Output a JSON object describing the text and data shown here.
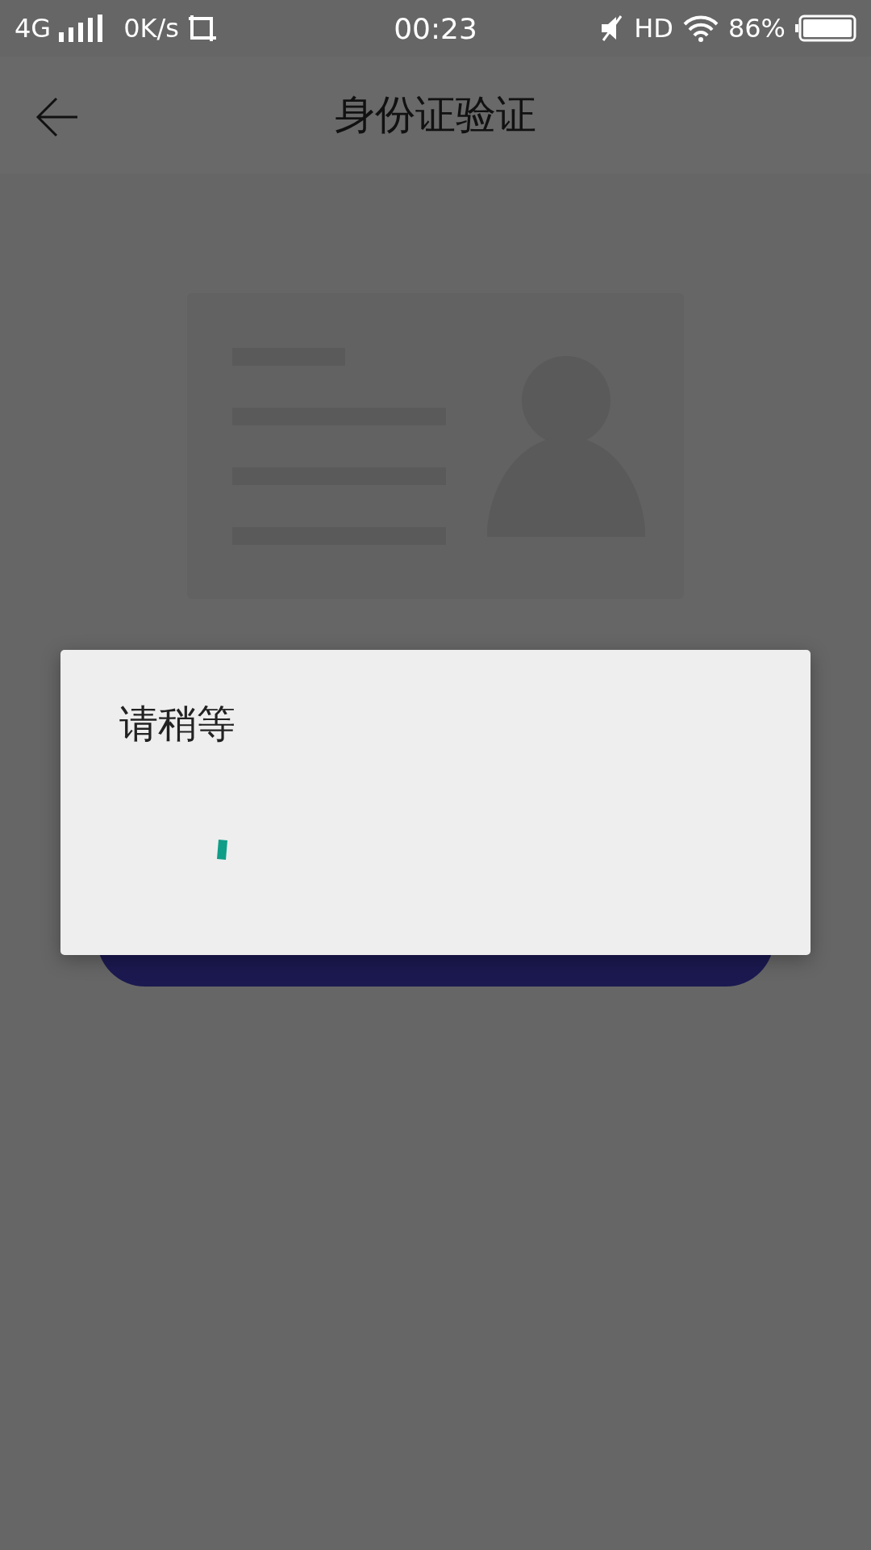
{
  "status_bar": {
    "network": "4G",
    "speed": "0K/s",
    "time": "00:23",
    "hd": "HD",
    "battery": "86%"
  },
  "header": {
    "title": "身份证验证"
  },
  "dialog": {
    "title": "请稍等"
  }
}
